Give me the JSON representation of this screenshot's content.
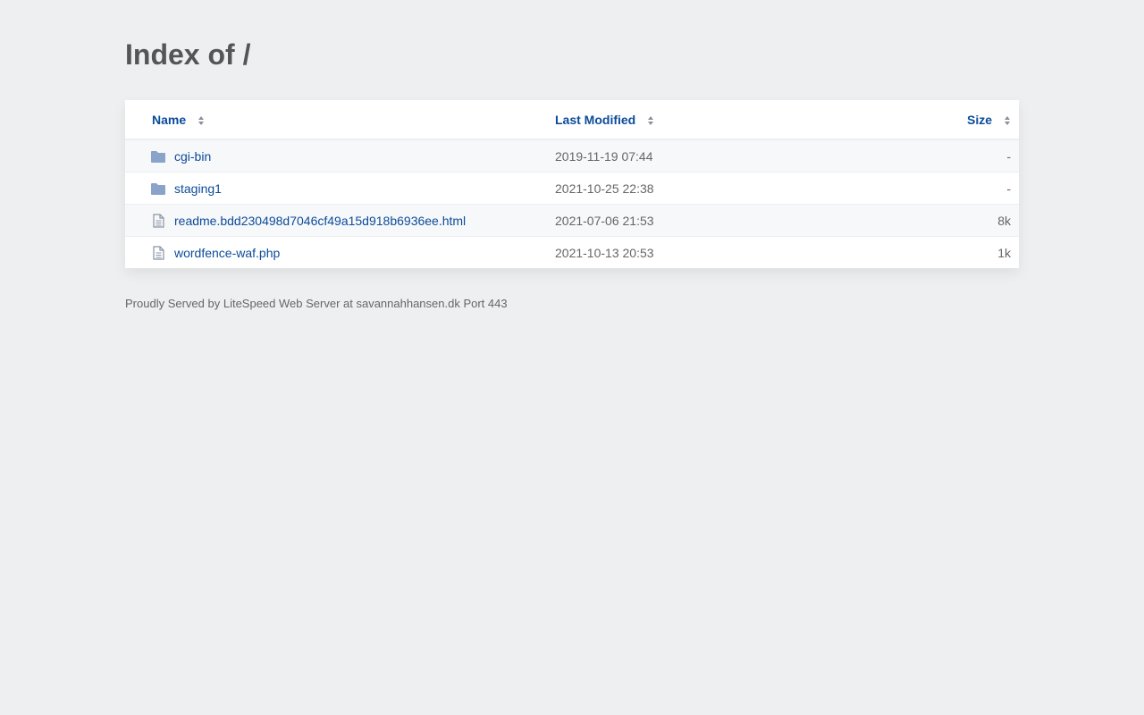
{
  "page": {
    "title": "Index of /",
    "footer": "Proudly Served by LiteSpeed Web Server at savannahhansen.dk Port 443"
  },
  "columns": {
    "name": "Name",
    "modified": "Last Modified",
    "size": "Size"
  },
  "entries": [
    {
      "name": "cgi-bin",
      "modified": "2019-11-19 07:44",
      "size": "-",
      "icon": "folder-icon"
    },
    {
      "name": "staging1",
      "modified": "2021-10-25 22:38",
      "size": "-",
      "icon": "folder-icon"
    },
    {
      "name": "readme.bdd230498d7046cf49a15d918b6936ee.html",
      "modified": "2021-07-06 21:53",
      "size": "8k",
      "icon": "file-icon"
    },
    {
      "name": "wordfence-waf.php",
      "modified": "2021-10-13 20:53",
      "size": "1k",
      "icon": "file-icon"
    }
  ],
  "colors": {
    "link": "#0b4b9a",
    "background": "#eeeff1",
    "folder": "#8aa3c9"
  }
}
